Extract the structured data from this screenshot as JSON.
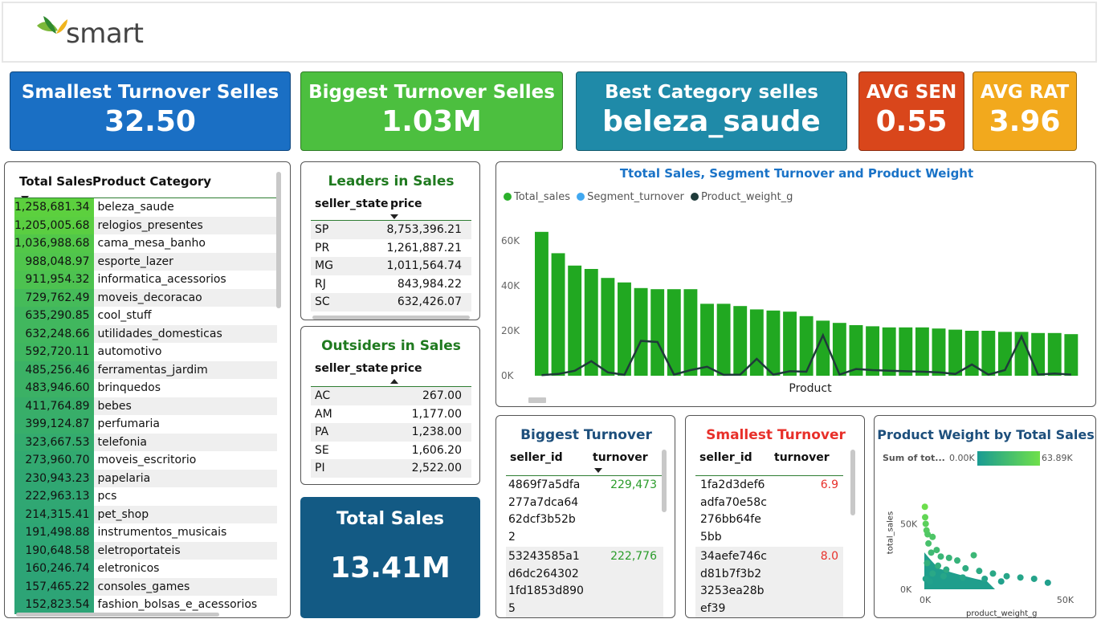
{
  "header": {
    "logo_text": "smart"
  },
  "kpis": [
    {
      "title": "Smallest Turnover Selles",
      "value": "32.50",
      "color": "#1a6fc4"
    },
    {
      "title": "Biggest Turnover Selles",
      "value": "1.03M",
      "color": "#4cbf3f"
    },
    {
      "title": "Best Category selles",
      "value": "beleza_saude",
      "color": "#1f8aa8"
    },
    {
      "title": "AVG SEN",
      "value": "0.55",
      "color": "#d9461b"
    },
    {
      "title": "AVG RAT",
      "value": "3.96",
      "color": "#f2a91d"
    }
  ],
  "category_table": {
    "col_total": "Total Sales",
    "col_category": "Product Category",
    "rows": [
      {
        "total": "1,258,681.34",
        "category": "beleza_saude",
        "pct": 1.0
      },
      {
        "total": "1,205,005.68",
        "category": "relogios_presentes",
        "pct": 0.957
      },
      {
        "total": "1,036,988.68",
        "category": "cama_mesa_banho",
        "pct": 0.824
      },
      {
        "total": "988,048.97",
        "category": "esporte_lazer",
        "pct": 0.785
      },
      {
        "total": "911,954.32",
        "category": "informatica_acessorios",
        "pct": 0.725
      },
      {
        "total": "729,762.49",
        "category": "moveis_decoracao",
        "pct": 0.58
      },
      {
        "total": "635,290.85",
        "category": "cool_stuff",
        "pct": 0.505
      },
      {
        "total": "632,248.66",
        "category": "utilidades_domesticas",
        "pct": 0.502
      },
      {
        "total": "592,720.11",
        "category": "automotivo",
        "pct": 0.471
      },
      {
        "total": "485,256.46",
        "category": "ferramentas_jardim",
        "pct": 0.386
      },
      {
        "total": "483,946.60",
        "category": "brinquedos",
        "pct": 0.384
      },
      {
        "total": "411,764.89",
        "category": "bebes",
        "pct": 0.327
      },
      {
        "total": "399,124.87",
        "category": "perfumaria",
        "pct": 0.317
      },
      {
        "total": "323,667.53",
        "category": "telefonia",
        "pct": 0.257
      },
      {
        "total": "273,960.70",
        "category": "moveis_escritorio",
        "pct": 0.218
      },
      {
        "total": "230,943.23",
        "category": "papelaria",
        "pct": 0.183
      },
      {
        "total": "222,963.13",
        "category": "pcs",
        "pct": 0.177
      },
      {
        "total": "214,315.41",
        "category": "pet_shop",
        "pct": 0.17
      },
      {
        "total": "191,498.88",
        "category": "instrumentos_musicais",
        "pct": 0.152
      },
      {
        "total": "190,648.58",
        "category": "eletroportateis",
        "pct": 0.151
      },
      {
        "total": "160,246.74",
        "category": "eletronicos",
        "pct": 0.127
      },
      {
        "total": "157,465.22",
        "category": "consoles_games",
        "pct": 0.125
      },
      {
        "total": "152,823.54",
        "category": "fashion_bolsas_e_acessorios",
        "pct": 0.121
      }
    ]
  },
  "leaders": {
    "title": "Leaders in Sales",
    "col_state": "seller_state",
    "col_price": "price",
    "rows": [
      {
        "state": "SP",
        "price": "8,753,396.21"
      },
      {
        "state": "PR",
        "price": "1,261,887.21"
      },
      {
        "state": "MG",
        "price": "1,011,564.74"
      },
      {
        "state": "RJ",
        "price": "843,984.22"
      },
      {
        "state": "SC",
        "price": "632,426.07"
      }
    ]
  },
  "outsiders": {
    "title": "Outsiders in Sales",
    "col_state": "seller_state",
    "col_price": "price",
    "rows": [
      {
        "state": "AC",
        "price": "267.00"
      },
      {
        "state": "AM",
        "price": "1,177.00"
      },
      {
        "state": "PA",
        "price": "1,238.00"
      },
      {
        "state": "SE",
        "price": "1,606.20"
      },
      {
        "state": "PI",
        "price": "2,522.00"
      }
    ]
  },
  "total_sales": {
    "title": "Total Sales",
    "value": "13.41M"
  },
  "combo_chart": {
    "title": "Ttotal Sales, Segment Turnover and Product Weight",
    "xlabel": "Product",
    "legend": [
      {
        "name": "Total_sales",
        "color": "#2bb02b"
      },
      {
        "name": "Segment_turnover",
        "color": "#41a8f0"
      },
      {
        "name": "Product_weight_g",
        "color": "#1f3b3a"
      }
    ],
    "y_ticks": [
      "60K",
      "40K",
      "20K",
      "0K"
    ]
  },
  "biggest_turnover": {
    "title": "Biggest Turnover",
    "col_id": "seller_id",
    "col_turn": "turnover",
    "rows": [
      {
        "id_lines": [
          "4869f7a5dfa",
          "277a7dca64",
          "62dcf3b52b",
          "2"
        ],
        "turnover": "229,473"
      },
      {
        "id_lines": [
          "53243585a1",
          "d6dc264302",
          "1fd1853d890",
          "5"
        ],
        "turnover": "222,776"
      }
    ]
  },
  "smallest_turnover": {
    "title": "Smallest Turnover",
    "col_id": "seller_id",
    "col_turn": "turnover",
    "rows": [
      {
        "id_lines": [
          "1fa2d3def6",
          "adfa70e58c",
          "276bb64fe",
          "5bb"
        ],
        "turnover": "6.9"
      },
      {
        "id_lines": [
          "34aefe746c",
          "d81b7f3b2",
          "3253ea28b",
          "ef39"
        ],
        "turnover": "8.0"
      }
    ]
  },
  "scatter": {
    "title": "Product Weight by Total Sales",
    "legend_label": "Sum of tot...",
    "legend_min": "0.00K",
    "legend_max": "63.89K",
    "y_label": "total_sales",
    "x_label": "product_weight_g",
    "y_ticks": [
      "50K",
      "0K"
    ],
    "x_ticks": [
      "0K",
      "50K"
    ]
  },
  "chart_data": [
    {
      "type": "bar",
      "title": "Ttotal Sales, Segment Turnover and Product Weight",
      "xlabel": "Product",
      "ylabel": "",
      "ylim": [
        0,
        70000
      ],
      "series": [
        {
          "name": "Total_sales",
          "values": [
            64000,
            54500,
            49000,
            47500,
            43500,
            41500,
            39000,
            38500,
            38500,
            38500,
            32000,
            32000,
            31000,
            29500,
            29000,
            28500,
            26500,
            24500,
            23500,
            22500,
            22000,
            21500,
            21500,
            21500,
            21000,
            20500,
            20000,
            20000,
            19500,
            19500,
            19000,
            19000,
            18500
          ]
        },
        {
          "name": "Product_weight_g",
          "values": [
            300,
            800,
            2200,
            6500,
            1500,
            400,
            15500,
            15000,
            500,
            2500,
            4000,
            400,
            500,
            7500,
            500,
            2000,
            1800,
            18000,
            500,
            3000,
            2500,
            2200,
            2000,
            1800,
            1500,
            800,
            5000,
            500,
            2500,
            17500,
            500,
            1000,
            500
          ]
        }
      ]
    },
    {
      "type": "scatter",
      "title": "Product Weight by Total Sales",
      "xlabel": "product_weight_g",
      "ylabel": "total_sales",
      "xlim": [
        0,
        55000
      ],
      "ylim": [
        0,
        65000
      ],
      "points": [
        [
          200,
          63000
        ],
        [
          300,
          55000
        ],
        [
          500,
          50000
        ],
        [
          800,
          45000
        ],
        [
          1200,
          42000
        ],
        [
          3000,
          40000
        ],
        [
          1500,
          35000
        ],
        [
          4500,
          30000
        ],
        [
          2500,
          28000
        ],
        [
          6000,
          25000
        ],
        [
          9000,
          24000
        ],
        [
          12000,
          22000
        ],
        [
          18000,
          26000
        ],
        [
          1000,
          20000
        ],
        [
          5000,
          18000
        ],
        [
          8000,
          15000
        ],
        [
          15000,
          16000
        ],
        [
          20000,
          14000
        ],
        [
          25000,
          12000
        ],
        [
          30000,
          10000
        ],
        [
          35000,
          9000
        ],
        [
          40000,
          8000
        ],
        [
          14000,
          9000
        ],
        [
          22000,
          8000
        ],
        [
          28000,
          6000
        ],
        [
          3000,
          12000
        ],
        [
          7000,
          10000
        ],
        [
          45000,
          5000
        ],
        [
          500,
          8000
        ],
        [
          2000,
          6000
        ]
      ]
    }
  ]
}
